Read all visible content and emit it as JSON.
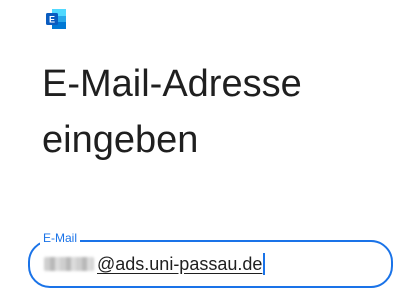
{
  "app": {
    "icon": "exchange-icon",
    "brand_color": "#0a64c8"
  },
  "heading": {
    "line1": "E-Mail-Adresse",
    "line2": "eingeben"
  },
  "email_field": {
    "label": "E-Mail",
    "value_domain": "@ads.uni-passau.de",
    "accent_color": "#1a73e8"
  }
}
